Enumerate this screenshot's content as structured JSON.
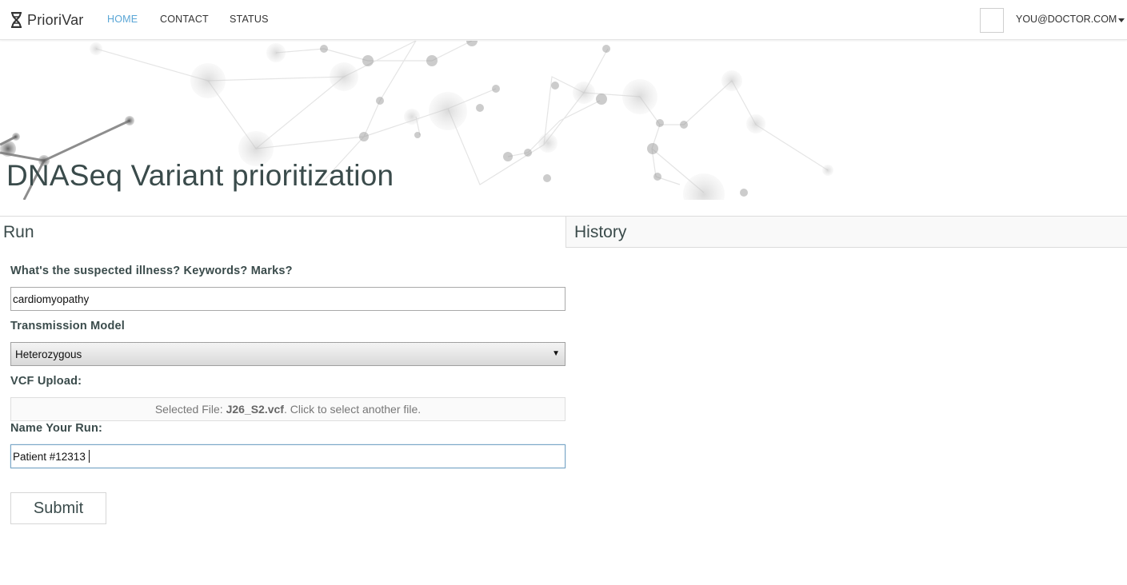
{
  "navbar": {
    "brand": "PrioriVar",
    "links": [
      {
        "label": "HOME",
        "active": true
      },
      {
        "label": "CONTACT",
        "active": false
      },
      {
        "label": "STATUS",
        "active": false
      }
    ],
    "user": "YOU@DOCTOR.COM"
  },
  "hero": {
    "title": "DNASeq Variant prioritization"
  },
  "panels": {
    "run": "Run",
    "history": "History"
  },
  "form": {
    "illness_label": "What's the suspected illness? Keywords? Marks?",
    "illness_value": "cardiomyopathy",
    "transmission_label": "Transmission Model",
    "transmission_selected": "Heterozygous",
    "vcf_label": "VCF Upload:",
    "vcf_prefix": "Selected File: ",
    "vcf_filename": "J26_S2.vcf",
    "vcf_suffix": ". Click to select another file.",
    "name_label": "Name Your Run:",
    "name_value": "Patient #12313",
    "submit_label": "Submit"
  },
  "colors": {
    "active_link": "#5aa6d6",
    "title_text": "#3a4b4b",
    "focus_border": "#7aa7c7"
  },
  "icons": {
    "brand": "dna-hourglass-icon",
    "user_menu": "caret-down-icon",
    "select": "triangle-down-icon"
  }
}
